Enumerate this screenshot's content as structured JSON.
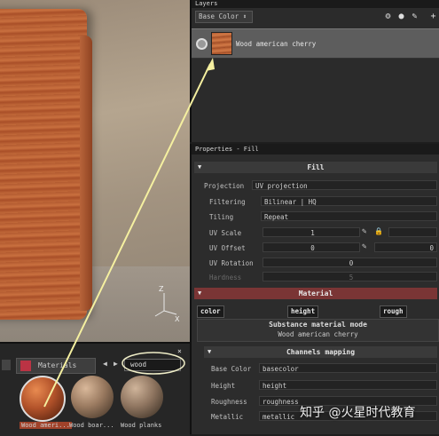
{
  "layers": {
    "title": "Layers",
    "channel_dropdown": "Base Color",
    "layer_name": "Wood american cherry"
  },
  "properties": {
    "title": "Properties - Fill",
    "fill_header": "Fill",
    "projection_label": "Projection",
    "projection_value": "UV projection",
    "filtering_label": "Filtering",
    "filtering_value": "Bilinear | HQ",
    "tiling_label": "Tiling",
    "tiling_value": "Repeat",
    "uv_scale_label": "UV Scale",
    "uv_scale_value": "1",
    "uv_offset_label": "UV Offset",
    "uv_offset_value": "0",
    "uv_offset_value2": "0",
    "uv_rotation_label": "UV Rotation",
    "uv_rotation_value": "0",
    "hardness_label": "Hardness",
    "hardness_value": "5",
    "material_header": "Material",
    "chip_color": "color",
    "chip_height": "height",
    "chip_rough": "rough",
    "substance_mode": "Substance material mode",
    "substance_name": "Wood american cherry",
    "channels_header": "Channels mapping",
    "basecolor_label": "Base Color",
    "basecolor_value": "basecolor",
    "height_label": "Height",
    "height_value": "height",
    "roughness_label": "Roughness",
    "roughness_value": "roughness",
    "metallic_label": "Metallic",
    "metallic_value": "metallic"
  },
  "shelf": {
    "tab_label": "Materials",
    "search_value": "wood",
    "items": [
      {
        "label": "Wood ameri..."
      },
      {
        "label": "Wood boar..."
      },
      {
        "label": "Wood planks"
      }
    ]
  },
  "viewport": {
    "axis_z": "Z",
    "axis_x": "X"
  },
  "watermark": "知乎 @火星时代教育",
  "colors": {
    "material_header": "#7a3535",
    "arrow": "#f5f0a0",
    "search_ellipse": "#f0eec8"
  }
}
